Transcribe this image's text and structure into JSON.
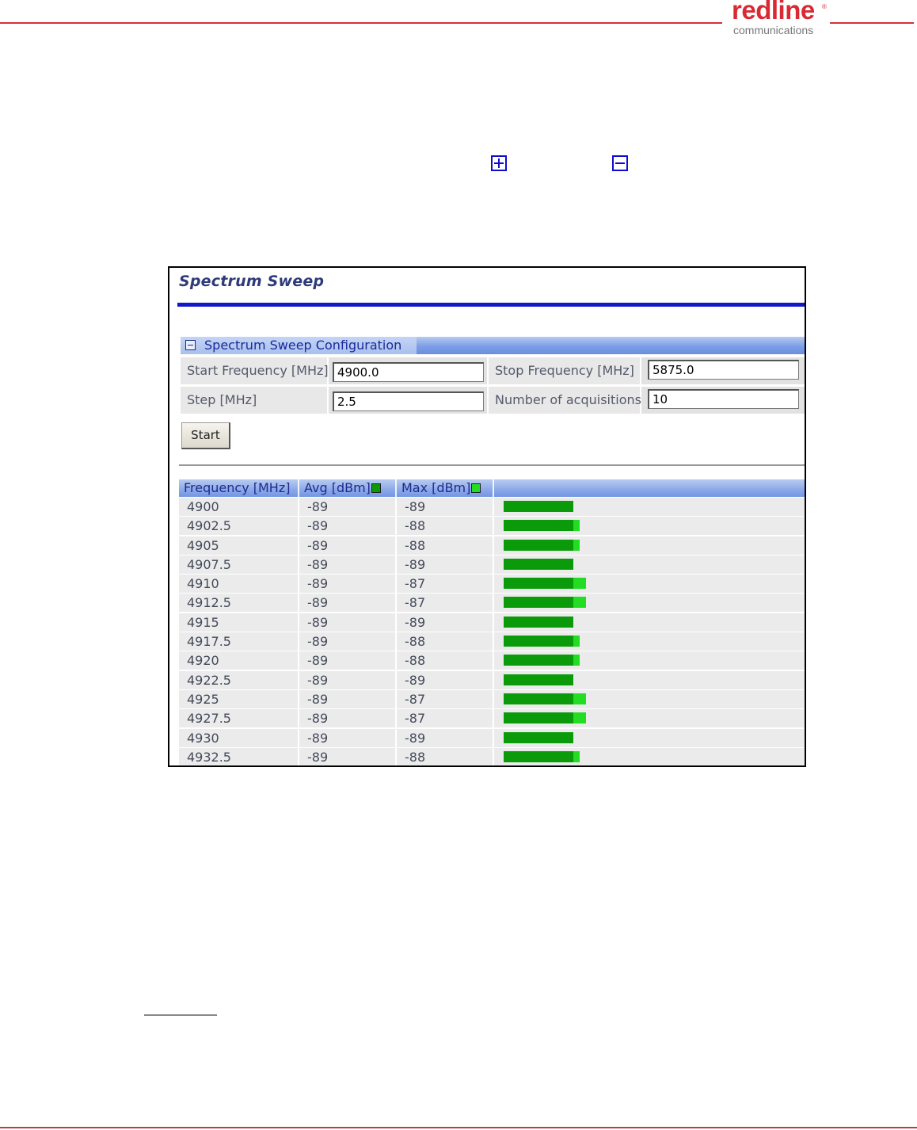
{
  "document": {
    "logo_word": "redline",
    "logo_registered": "®",
    "logo_sub": "communications",
    "colors": {
      "rule": "#d4303a",
      "logo": "#d92a34",
      "icon": "#0d0dcc"
    },
    "inline_icons": [
      "expand-plus-icon",
      "collapse-minus-icon"
    ]
  },
  "screen": {
    "title": "Spectrum Sweep",
    "section": {
      "title": "Spectrum Sweep Configuration",
      "toggle_icon": "collapse-minus-icon"
    },
    "config": {
      "start_frequency_label": "Start Frequency [MHz]",
      "start_frequency_value": "4900.0",
      "stop_frequency_label": "Stop Frequency [MHz]",
      "stop_frequency_value": "5875.0",
      "step_label": "Step [MHz]",
      "step_value": "2.5",
      "acquisitions_label": "Number of acquisitions",
      "acquisitions_value": "10"
    },
    "start_button": "Start",
    "results": {
      "columns": [
        "Frequency [MHz]",
        "Avg [dBm]",
        "Max [dBm]"
      ],
      "colors": {
        "avg": "#0a9a0a",
        "max": "#22dd22",
        "header": "#8aa8e8"
      },
      "scale_floor_dbm": -100,
      "rows": [
        {
          "freq": "4900",
          "avg": "-89",
          "max": "-89"
        },
        {
          "freq": "4902.5",
          "avg": "-89",
          "max": "-88"
        },
        {
          "freq": "4905",
          "avg": "-89",
          "max": "-88"
        },
        {
          "freq": "4907.5",
          "avg": "-89",
          "max": "-89"
        },
        {
          "freq": "4910",
          "avg": "-89",
          "max": "-87"
        },
        {
          "freq": "4912.5",
          "avg": "-89",
          "max": "-87"
        },
        {
          "freq": "4915",
          "avg": "-89",
          "max": "-89"
        },
        {
          "freq": "4917.5",
          "avg": "-89",
          "max": "-88"
        },
        {
          "freq": "4920",
          "avg": "-89",
          "max": "-88"
        },
        {
          "freq": "4922.5",
          "avg": "-89",
          "max": "-89"
        },
        {
          "freq": "4925",
          "avg": "-89",
          "max": "-87"
        },
        {
          "freq": "4927.5",
          "avg": "-89",
          "max": "-87"
        },
        {
          "freq": "4930",
          "avg": "-89",
          "max": "-89"
        },
        {
          "freq": "4932.5",
          "avg": "-89",
          "max": "-88"
        }
      ]
    }
  }
}
